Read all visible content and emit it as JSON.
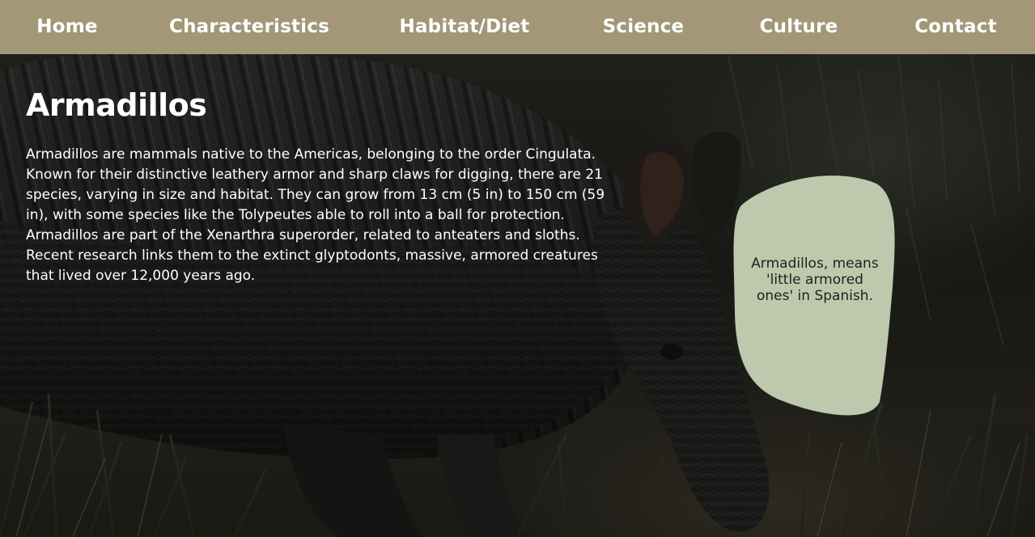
{
  "nav": {
    "items": [
      {
        "label": "Home"
      },
      {
        "label": "Characteristics"
      },
      {
        "label": "Habitat/Diet"
      },
      {
        "label": "Science"
      },
      {
        "label": "Culture"
      },
      {
        "label": "Contact"
      }
    ]
  },
  "main": {
    "title": "Armadillos",
    "intro": "Armadillos are mammals native to the Americas, belonging to the order Cingulata. Known for their distinctive leathery armor and sharp claws for digging, there are 21 species, varying in size and habitat. They can grow from 13 cm (5 in) to 150 cm (59 in), with some species like the Tolypeutes able to roll into a ball for protection. Armadillos are part of the Xenarthra superorder, related to anteaters and sloths. Recent research links them to the extinct glyptodonts, massive, armored creatures that lived over 12,000 years ago."
  },
  "fact": {
    "text": "Armadillos, means 'little armored ones' in Spanish."
  },
  "colors": {
    "nav_background": "#a39778",
    "fact_background": "#bdc8ad",
    "text_light": "#ffffff"
  },
  "background": {
    "image": "armadillo-photo"
  }
}
